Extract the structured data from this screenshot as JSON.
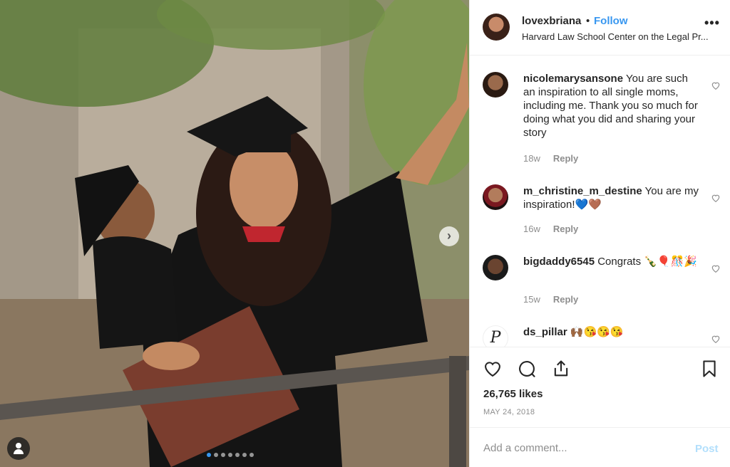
{
  "post": {
    "username": "lovexbriana",
    "separator": "•",
    "follow_label": "Follow",
    "location": "Harvard Law School Center on the Legal Pr...",
    "more_label": "•••",
    "photo": {
      "next_label": "›",
      "slides_total": 7,
      "slide_active": 1
    }
  },
  "comments": [
    {
      "username": "nicolemarysansone",
      "text": "You are such an inspiration to all single moms, including me. Thank you so much for doing what you did and sharing your story",
      "age": "18w",
      "reply_label": "Reply"
    },
    {
      "username": "m_christine_m_destine",
      "text": "You are my inspiration!💙🤎",
      "age": "16w",
      "reply_label": "Reply"
    },
    {
      "username": "bigdaddy6545",
      "text": "Congrats 🍾🎈🎊🎉",
      "age": "15w",
      "reply_label": "Reply"
    },
    {
      "username": "ds_pillar",
      "text": "🙌🏾😘😘😘",
      "avatar_letter": "P"
    }
  ],
  "actions": {
    "likes": "26,765 likes",
    "date": "MAY 24, 2018"
  },
  "add_comment": {
    "placeholder": "Add a comment...",
    "post_label": "Post"
  },
  "colors": {
    "link_blue": "#3897f0",
    "post_disabled": "#b2dffc",
    "muted": "#8e8e8e"
  }
}
